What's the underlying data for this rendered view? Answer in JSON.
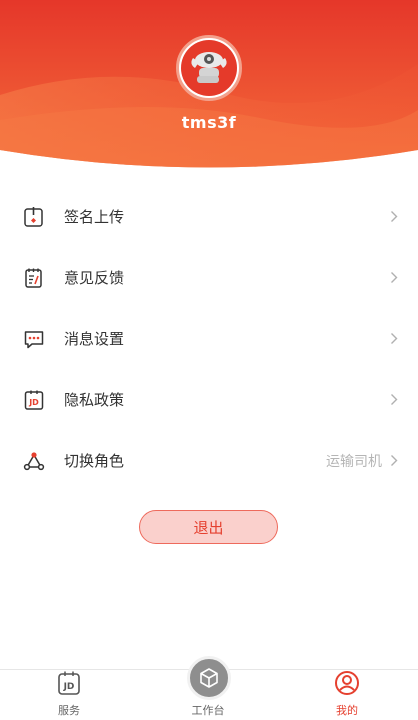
{
  "profile": {
    "username": "tms3f"
  },
  "menu": {
    "items": [
      {
        "key": "signature",
        "label": "签名上传",
        "value": "",
        "icon": "signature-upload-icon"
      },
      {
        "key": "feedback",
        "label": "意见反馈",
        "value": "",
        "icon": "feedback-notepad-icon"
      },
      {
        "key": "messages",
        "label": "消息设置",
        "value": "",
        "icon": "message-bubble-icon"
      },
      {
        "key": "privacy",
        "label": "隐私政策",
        "value": "",
        "icon": "jd-document-icon"
      },
      {
        "key": "role",
        "label": "切换角色",
        "value": "运输司机",
        "icon": "switch-role-icon"
      }
    ]
  },
  "logout": {
    "label": "退出"
  },
  "tabbar": {
    "tabs": [
      {
        "key": "services",
        "label": "服务",
        "icon": "jd-services-icon",
        "active": false
      },
      {
        "key": "workbench",
        "label": "工作台",
        "icon": "cube-workbench-icon",
        "active": false
      },
      {
        "key": "mine",
        "label": "我的",
        "icon": "user-profile-icon",
        "active": true
      }
    ]
  },
  "colors": {
    "accent": "#e5402f",
    "header_top": "#e6392a",
    "header_bottom": "#f36a3c",
    "logout_bg": "#fad0cc"
  }
}
